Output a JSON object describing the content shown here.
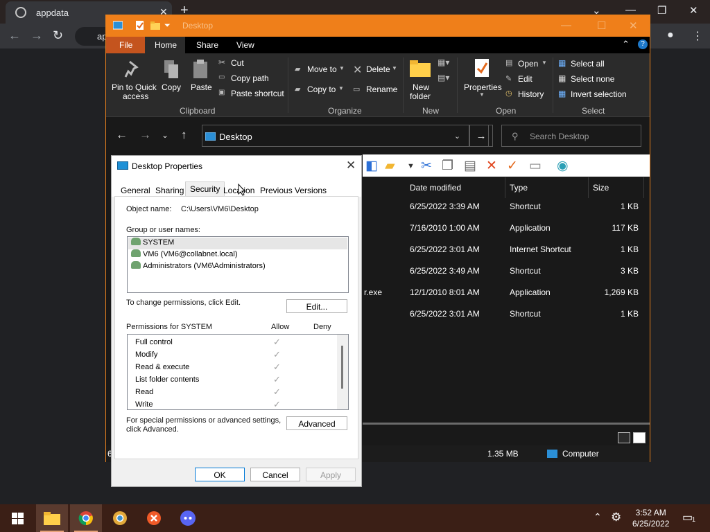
{
  "chrome": {
    "tab_title": "appdata",
    "tab_close": "✕",
    "new_tab": "+",
    "omnibox_text": "ap",
    "minimize": "⌄",
    "restore": "—",
    "maximize": "❐",
    "close": "✕"
  },
  "explorer": {
    "title": "Desktop",
    "tabs": {
      "file": "File",
      "home": "Home",
      "share": "Share",
      "view": "View"
    },
    "ribbon": {
      "pin_label_1": "Pin to Quick",
      "pin_label_2": "access",
      "copy": "Copy",
      "paste": "Paste",
      "cut": "Cut",
      "copy_path": "Copy path",
      "paste_shortcut": "Paste shortcut",
      "move_to": "Move to",
      "copy_to": "Copy to",
      "delete": "Delete",
      "rename": "Rename",
      "new_folder_1": "New",
      "new_folder_2": "folder",
      "properties": "Properties",
      "open": "Open",
      "edit": "Edit",
      "history": "History",
      "select_all": "Select all",
      "select_none": "Select none",
      "invert_selection": "Invert selection",
      "groups": {
        "clipboard": "Clipboard",
        "organize": "Organize",
        "new": "New",
        "open": "Open",
        "select": "Select"
      }
    },
    "address": "Desktop",
    "search_placeholder": "Search Desktop",
    "columns": {
      "date": "Date modified",
      "type": "Type",
      "size": "Size"
    },
    "rows": [
      {
        "name": "",
        "date": "6/25/2022 3:39 AM",
        "type": "Shortcut",
        "size": "1 KB"
      },
      {
        "name": "",
        "date": "7/16/2010 1:00 AM",
        "type": "Application",
        "size": "117 KB"
      },
      {
        "name": "",
        "date": "6/25/2022 3:01 AM",
        "type": "Internet Shortcut",
        "size": "1 KB"
      },
      {
        "name": "",
        "date": "6/25/2022 3:49 AM",
        "type": "Shortcut",
        "size": "3 KB"
      },
      {
        "name": "r.exe",
        "date": "12/1/2010 8:01 AM",
        "type": "Application",
        "size": "1,269 KB"
      },
      {
        "name": "",
        "date": "6/25/2022 3:01 AM",
        "type": "Shortcut",
        "size": "1 KB"
      }
    ],
    "status": {
      "left": "6",
      "size": "1.35 MB",
      "location": "Computer"
    }
  },
  "dialog": {
    "title": "Desktop Properties",
    "tabs": [
      "General",
      "Sharing",
      "Security",
      "Location",
      "Previous Versions"
    ],
    "object_name_label": "Object name:",
    "object_name_value": "C:\\Users\\VM6\\Desktop",
    "group_label": "Group or user names:",
    "users": [
      "SYSTEM",
      "VM6 (VM6@collabnet.local)",
      "Administrators (VM6\\Administrators)"
    ],
    "change_text": "To change permissions, click Edit.",
    "edit_button": "Edit...",
    "permissions_label": "Permissions for SYSTEM",
    "allow": "Allow",
    "deny": "Deny",
    "permissions": [
      "Full control",
      "Modify",
      "Read & execute",
      "List folder contents",
      "Read",
      "Write"
    ],
    "special_text_1": "For special permissions or advanced settings,",
    "special_text_2": "click Advanced.",
    "advanced_button": "Advanced",
    "ok": "OK",
    "cancel": "Cancel",
    "apply": "Apply"
  },
  "taskbar": {
    "time": "3:52 AM",
    "date": "6/25/2022"
  }
}
